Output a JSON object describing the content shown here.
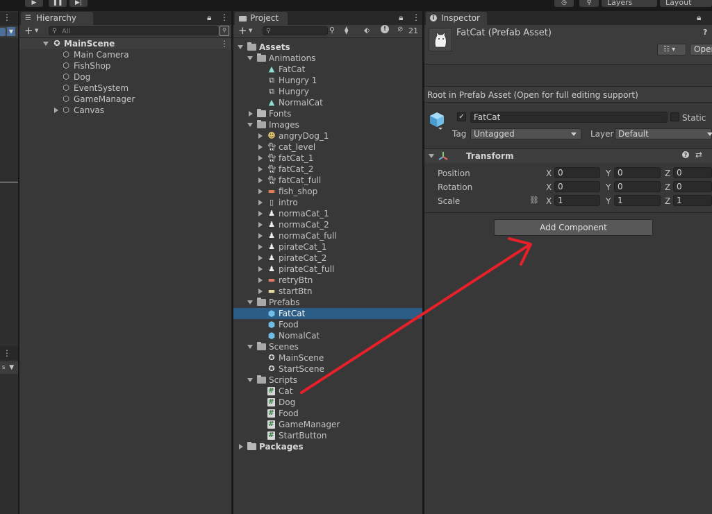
{
  "toolbar": {
    "play_icon": "play-icon",
    "pause_icon": "pause-icon",
    "step_icon": "step-icon",
    "layers_label": "Layers",
    "layout_label": "Layout"
  },
  "hierarchy": {
    "tab_label": "Hierarchy",
    "search_placeholder": "All",
    "scene_name": "MainScene",
    "items": [
      "Main Camera",
      "FishShop",
      "Dog",
      "EventSystem",
      "GameManager",
      "Canvas"
    ]
  },
  "project": {
    "tab_label": "Project",
    "hidden_count": "21",
    "root": "Assets",
    "animations": {
      "label": "Animations",
      "items": [
        "FatCat",
        "Hungry 1",
        "Hungry",
        "NormalCat"
      ]
    },
    "fonts": {
      "label": "Fonts"
    },
    "images": {
      "label": "Images",
      "items": [
        "angryDog_1",
        "cat_level",
        "fatCat_1",
        "fatCat_2",
        "fatCat_full",
        "fish_shop",
        "intro",
        "normaCat_1",
        "normaCat_2",
        "normaCat_full",
        "pirateCat_1",
        "pirateCat_2",
        "pirateCat_full",
        "retryBtn",
        "startBtn"
      ]
    },
    "prefabs": {
      "label": "Prefabs",
      "items": [
        "FatCat",
        "Food",
        "NomalCat"
      ],
      "selected": "FatCat"
    },
    "scenes": {
      "label": "Scenes",
      "items": [
        "MainScene",
        "StartScene"
      ]
    },
    "scripts": {
      "label": "Scripts",
      "items": [
        "Cat",
        "Dog",
        "Food",
        "GameManager",
        "StartButton"
      ]
    },
    "packages": "Packages"
  },
  "inspector": {
    "tab_label": "Inspector",
    "asset_title": "FatCat (Prefab Asset)",
    "open_label": "Open",
    "notice": "Root in Prefab Asset (Open for full editing support)",
    "object_name": "FatCat",
    "static_label": "Static",
    "tag_label": "Tag",
    "tag_value": "Untagged",
    "layer_label": "Layer",
    "layer_value": "Default",
    "transform": {
      "title": "Transform",
      "position_label": "Position",
      "rotation_label": "Rotation",
      "scale_label": "Scale",
      "x": "X",
      "y": "Y",
      "z": "Z",
      "position": [
        "0",
        "0",
        "0"
      ],
      "rotation": [
        "0",
        "0",
        "0"
      ],
      "scale": [
        "1",
        "1",
        "1"
      ]
    },
    "add_component_label": "Add Component"
  },
  "annotation": {
    "color": "#e8202a"
  }
}
